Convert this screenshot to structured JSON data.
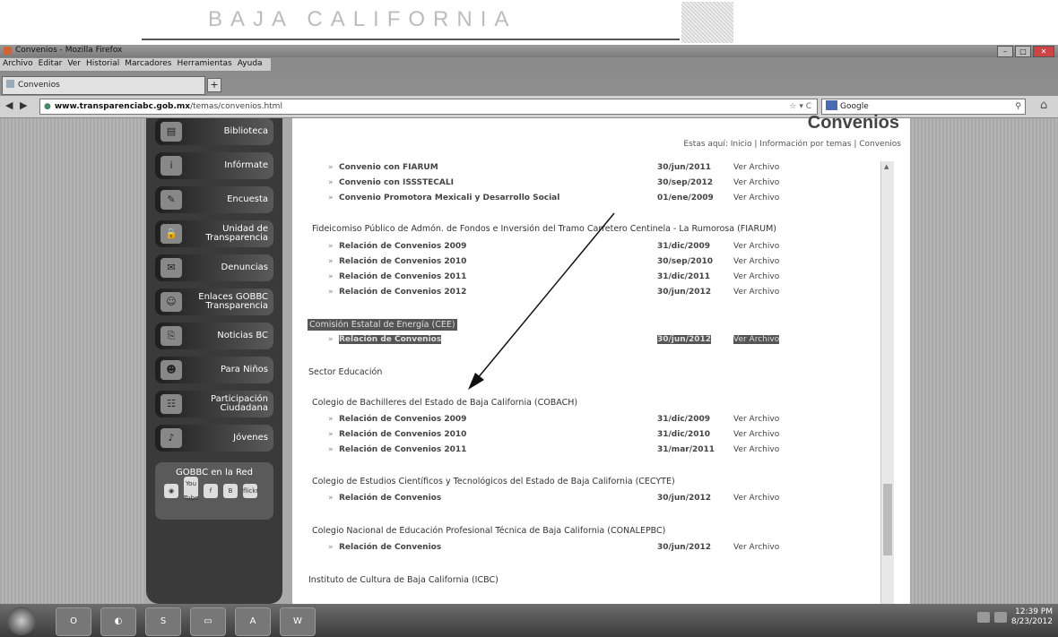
{
  "banner": {
    "title": "BAJA CALIFORNIA"
  },
  "window": {
    "title": "Convenios - Mozilla Firefox",
    "menu": [
      "Archivo",
      "Editar",
      "Ver",
      "Historial",
      "Marcadores",
      "Herramientas",
      "Ayuda"
    ],
    "tab": "Convenios",
    "newtab": "+",
    "url_host": "www.transparenciabc.gob.mx",
    "url_path": "/temas/convenios.html",
    "search_placeholder": "Google"
  },
  "sidebar": {
    "items": [
      {
        "label": "Biblioteca"
      },
      {
        "label": "Infórmate"
      },
      {
        "label": "Encuesta"
      },
      {
        "label": "Unidad de Transparencia"
      },
      {
        "label": "Denuncias"
      },
      {
        "label": "Enlaces GOBBC Transparencia"
      },
      {
        "label": "Noticias BC"
      },
      {
        "label": "Para Niños"
      },
      {
        "label": "Participación Ciudadana"
      },
      {
        "label": "Jóvenes"
      }
    ],
    "social_title": "GOBBC en la Red",
    "social": [
      "You Tube",
      "f",
      "B",
      "flickr"
    ]
  },
  "page": {
    "heading": "Convenios",
    "breadcrumb": "Estas aquí: Inicio | Información por temas | Convenios",
    "rows_top": [
      {
        "label": "Convenio con FIARUM",
        "date": "30/jun/2011",
        "link": "Ver Archivo"
      },
      {
        "label": "Convenio con ISSSTECALI",
        "date": "30/sep/2012",
        "link": "Ver Archivo"
      },
      {
        "label": "Convenio Promotora Mexicali y Desarrollo Social",
        "date": "01/ene/2009",
        "link": "Ver Archivo"
      }
    ],
    "fiarum_title": "Fideicomiso Público de Admón. de Fondos e Inversión del Tramo Carretero Centinela - La Rumorosa (FIARUM)",
    "fiarum_rows": [
      {
        "label": "Relación de Convenios 2009",
        "date": "31/dic/2009",
        "link": "Ver Archivo"
      },
      {
        "label": "Relación de Convenios 2010",
        "date": "30/sep/2010",
        "link": "Ver Archivo"
      },
      {
        "label": "Relación de Convenios 2011",
        "date": "31/dic/2011",
        "link": "Ver Archivo"
      },
      {
        "label": "Relación de Convenios 2012",
        "date": "30/jun/2012",
        "link": "Ver Archivo"
      }
    ],
    "energia_title": "Comisión Estatal de Energía (CEE)",
    "energia_row": {
      "label": "Relación de Convenios",
      "date": "30/jun/2012",
      "link": "Ver Archivo"
    },
    "educacion_title": "Sector Educación",
    "cobach_title": "Colegio de Bachilleres del Estado de Baja California (COBACH)",
    "cobach_rows": [
      {
        "label": "Relación de Convenios 2009",
        "date": "31/dic/2009",
        "link": "Ver Archivo"
      },
      {
        "label": "Relación de Convenios 2010",
        "date": "31/dic/2010",
        "link": "Ver Archivo"
      },
      {
        "label": "Relación de Convenios 2011",
        "date": "31/mar/2011",
        "link": "Ver Archivo"
      }
    ],
    "cecyte_title": "Colegio de Estudios Científicos y Tecnológicos del Estado de Baja California (CECYTE)",
    "cecyte_row": {
      "label": "Relación de Convenios",
      "date": "30/jun/2012",
      "link": "Ver Archivo"
    },
    "conalep_title": "Colegio Nacional de Educación Profesional Técnica de Baja California (CONALEPBC)",
    "conalep_row": {
      "label": "Relación de Convenios",
      "date": "30/jun/2012",
      "link": "Ver Archivo"
    },
    "icbc_title": "Instituto de Cultura de Baja California (ICBC)"
  },
  "taskbar": {
    "apps": [
      "O",
      "",
      "S",
      "",
      "A",
      "W"
    ],
    "time": "12:39 PM",
    "date": "8/23/2012"
  }
}
